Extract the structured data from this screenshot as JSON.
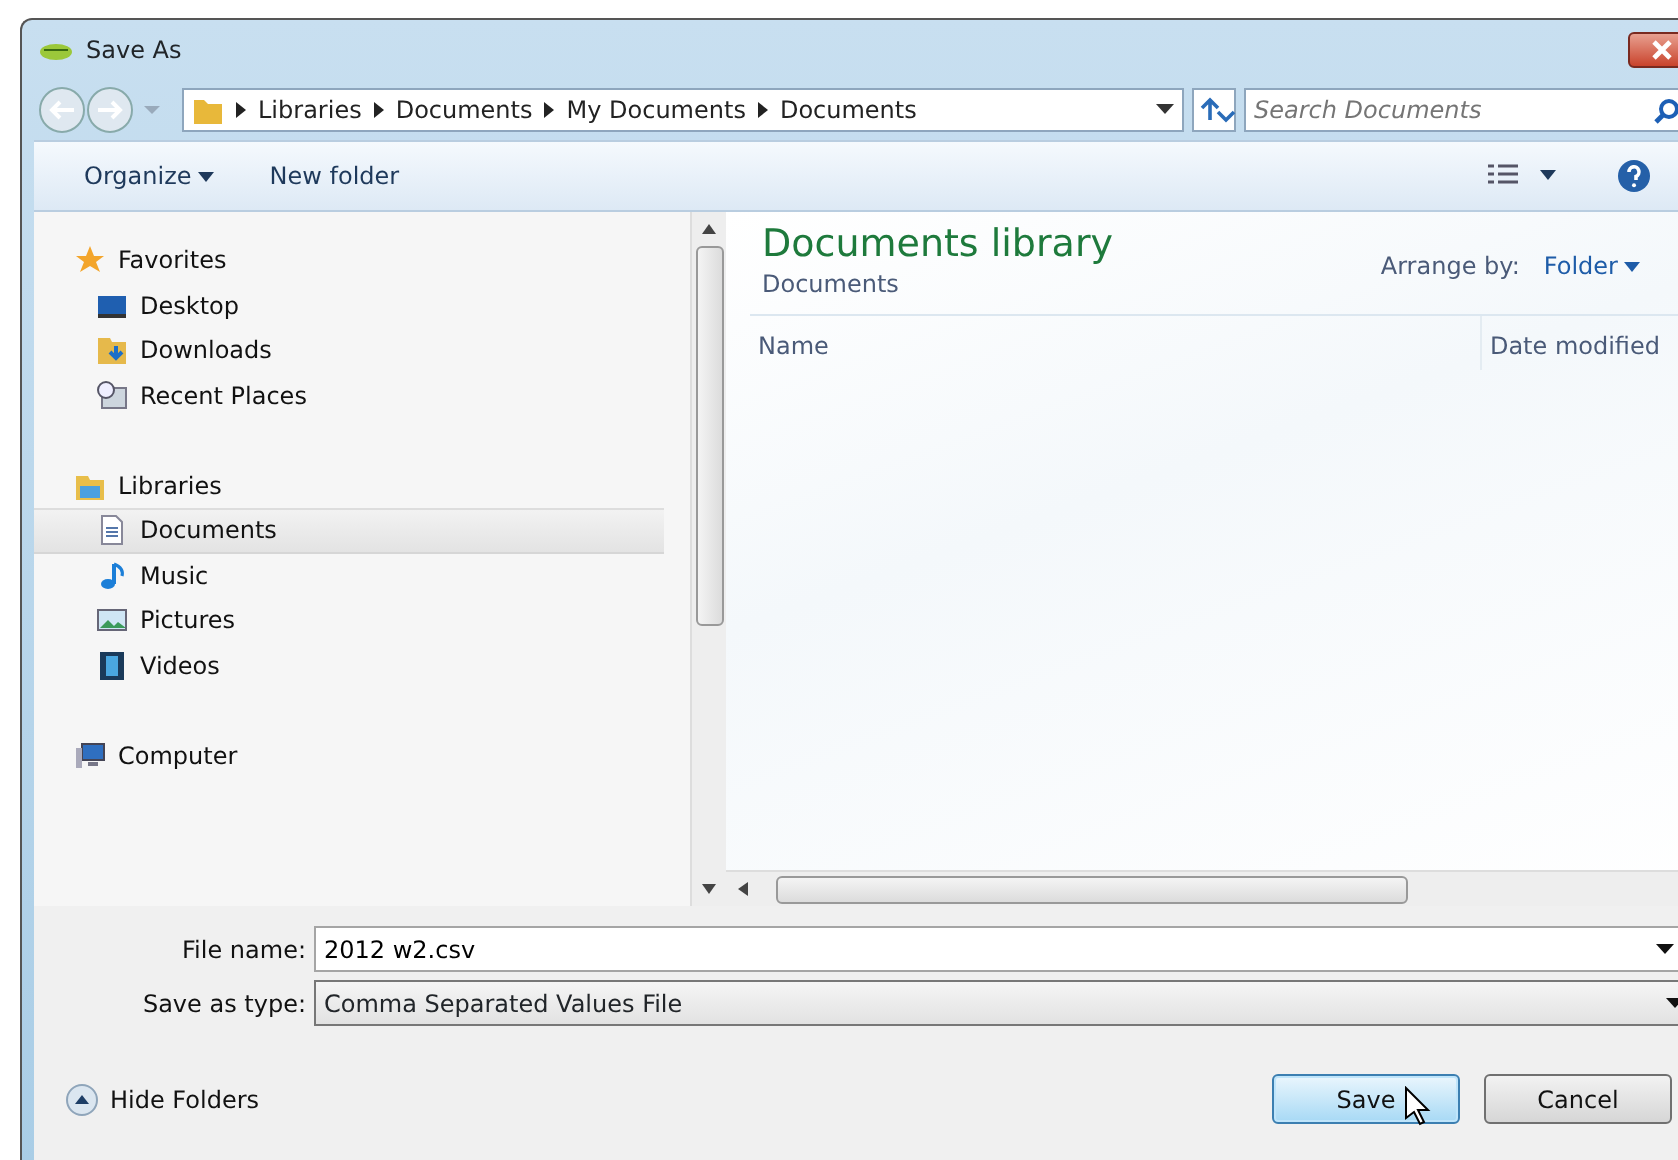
{
  "window": {
    "title": "Save As"
  },
  "address_bar": {
    "path": [
      "Libraries",
      "Documents",
      "My Documents",
      "Documents"
    ]
  },
  "search": {
    "placeholder": "Search Documents"
  },
  "toolbar": {
    "organize": "Organize",
    "new_folder": "New folder"
  },
  "nav_tree": [
    {
      "label": "Favorites",
      "kind": "star",
      "selected": false,
      "children": [
        {
          "label": "Desktop",
          "kind": "desktop",
          "selected": false
        },
        {
          "label": "Downloads",
          "kind": "downloads",
          "selected": false
        },
        {
          "label": "Recent Places",
          "kind": "recent",
          "selected": false
        }
      ]
    },
    {
      "label": "Libraries",
      "kind": "library",
      "selected": false,
      "children": [
        {
          "label": "Documents",
          "kind": "document",
          "selected": true
        },
        {
          "label": "Music",
          "kind": "music",
          "selected": false
        },
        {
          "label": "Pictures",
          "kind": "pictures",
          "selected": false
        },
        {
          "label": "Videos",
          "kind": "videos",
          "selected": false
        }
      ]
    },
    {
      "label": "Computer",
      "kind": "computer",
      "selected": false
    }
  ],
  "content": {
    "title": "Documents library",
    "subtitle": "Documents",
    "arrange_label": "Arrange by:",
    "arrange_value": "Folder",
    "columns": [
      "Name",
      "Date modified"
    ]
  },
  "form": {
    "file_name_label": "File name:",
    "file_name": "2012 w2.csv",
    "type_label": "Save as type:",
    "type_value": "Comma Separated Values File"
  },
  "footer": {
    "hide_folders": "Hide Folders",
    "buttons": [
      {
        "label": "Save",
        "default": true
      },
      {
        "label": "Cancel",
        "default": false
      }
    ]
  }
}
